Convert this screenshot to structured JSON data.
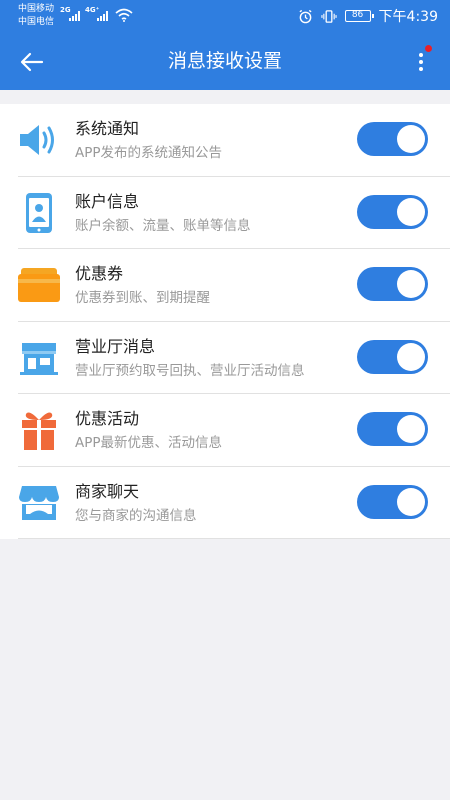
{
  "status_bar": {
    "carrier_1": "中国移动",
    "carrier_2": "中国电信",
    "network_1": "2G",
    "network_2": "4G⁺",
    "battery": "86",
    "time": "下午4:39"
  },
  "header": {
    "title": "消息接收设置",
    "has_notification_badge": true,
    "accent_color": "#2f7ee0",
    "badge_color": "#e8202a"
  },
  "settings": [
    {
      "id": "system",
      "icon": "speaker-icon",
      "label": "系统通知",
      "desc": "APP发布的系统通知公告",
      "enabled": true
    },
    {
      "id": "account",
      "icon": "phone-user-icon",
      "label": "账户信息",
      "desc": "账户余额、流量、账单等信息",
      "enabled": true
    },
    {
      "id": "coupon",
      "icon": "coupon-icon",
      "label": "优惠券",
      "desc": "优惠券到账、到期提醒",
      "enabled": true
    },
    {
      "id": "hall",
      "icon": "store-icon",
      "label": "营业厅消息",
      "desc": "营业厅预约取号回执、营业厅活动信息",
      "enabled": true
    },
    {
      "id": "promo",
      "icon": "gift-icon",
      "label": "优惠活动",
      "desc": "APP最新优惠、活动信息",
      "enabled": true
    },
    {
      "id": "merchant",
      "icon": "shop-icon",
      "label": "商家聊天",
      "desc": "您与商家的沟通信息",
      "enabled": true
    }
  ]
}
